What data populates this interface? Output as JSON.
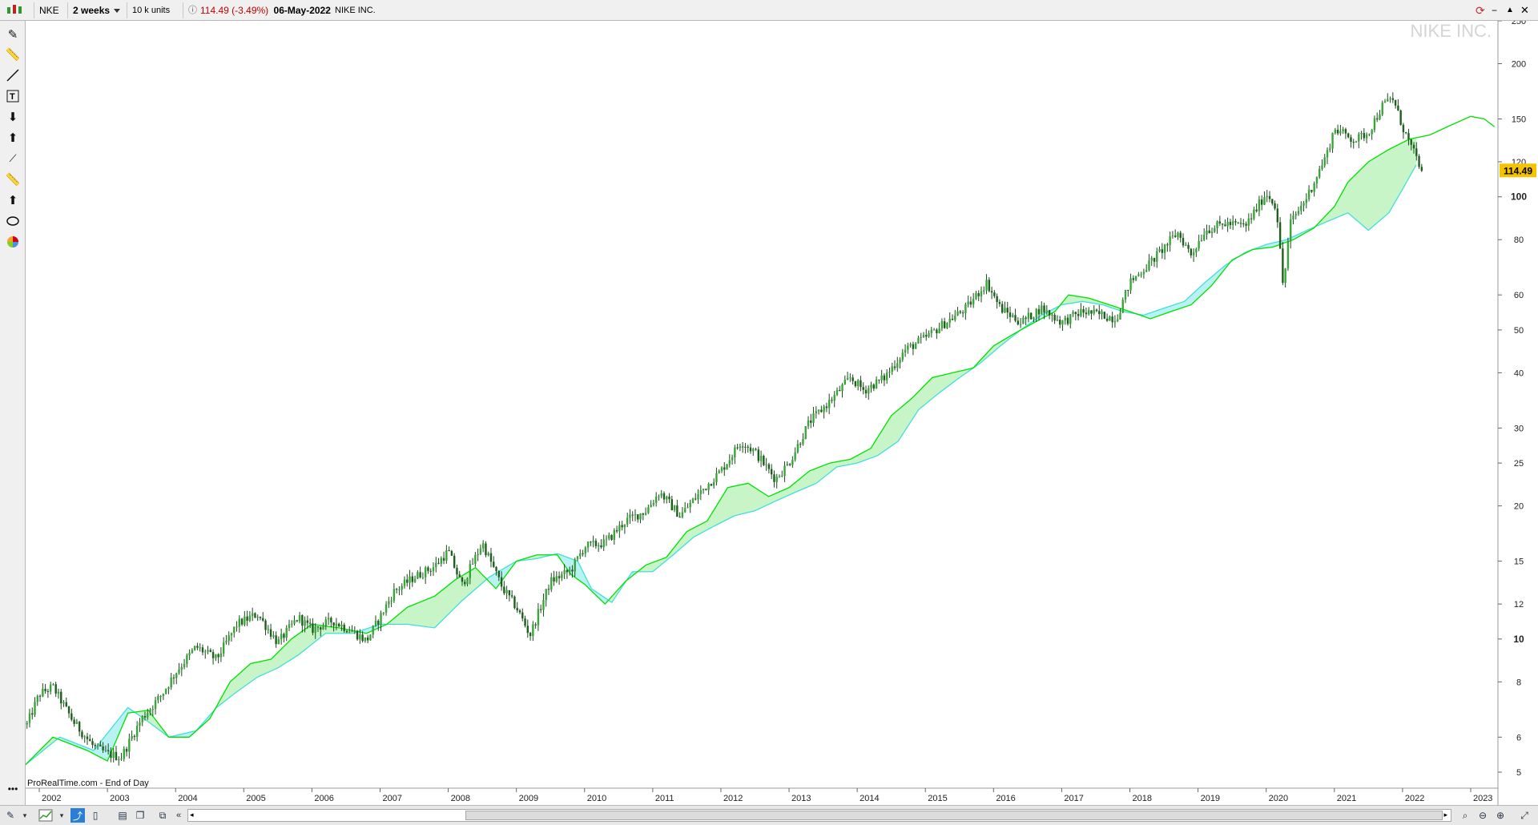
{
  "header": {
    "symbol": "NKE",
    "period": "2 weeks",
    "units": "10 k units",
    "last_price": "114.49",
    "change": "(-3.49%)",
    "date": "06-May-2022",
    "instrument": "NIKE INC."
  },
  "watermark": "NIKE INC.",
  "source_label": "ProRealTime.com - End of Day",
  "price_tag": "114.49",
  "colors": {
    "candle": "#1b7a1b",
    "cloud_bull": "#c8f5c8",
    "cloud_bear": "#b9f2f2",
    "span_a": "#00e000",
    "span_b": "#44dddd",
    "price_tag_bg": "#f5c400"
  },
  "chart_data": {
    "type": "line",
    "yscale": "log",
    "ylim": [
      4.6,
      250
    ],
    "xlim": [
      2001.8,
      2023.4
    ],
    "y_ticks": [
      5,
      6,
      8,
      10,
      12,
      15,
      20,
      25,
      30,
      40,
      50,
      60,
      80,
      100,
      120,
      150,
      200,
      250
    ],
    "y_major_ticks": [
      10,
      100
    ],
    "x_ticks": [
      "2002",
      "2003",
      "2004",
      "2005",
      "2006",
      "2007",
      "2008",
      "2009",
      "2010",
      "2011",
      "2012",
      "2013",
      "2014",
      "2015",
      "2016",
      "2017",
      "2018",
      "2019",
      "2020",
      "2021",
      "2022",
      "2023"
    ],
    "price": {
      "x": [
        2001.8,
        2002.0,
        2002.2,
        2002.5,
        2002.8,
        2003.0,
        2003.2,
        2003.5,
        2003.8,
        2004.0,
        2004.3,
        2004.6,
        2004.9,
        2005.2,
        2005.5,
        2005.8,
        2006.0,
        2006.3,
        2006.6,
        2006.8,
        2007.0,
        2007.2,
        2007.5,
        2007.8,
        2008.0,
        2008.2,
        2008.5,
        2008.8,
        2009.0,
        2009.2,
        2009.5,
        2009.8,
        2010.0,
        2010.3,
        2010.6,
        2010.9,
        2011.1,
        2011.4,
        2011.7,
        2012.0,
        2012.3,
        2012.5,
        2012.8,
        2013.0,
        2013.3,
        2013.6,
        2013.9,
        2014.1,
        2014.4,
        2014.7,
        2015.0,
        2015.3,
        2015.6,
        2015.9,
        2016.1,
        2016.4,
        2016.7,
        2017.0,
        2017.3,
        2017.6,
        2017.8,
        2018.0,
        2018.3,
        2018.7,
        2018.9,
        2019.1,
        2019.4,
        2019.7,
        2020.0,
        2020.15,
        2020.25,
        2020.35,
        2020.6,
        2020.9,
        2021.0,
        2021.3,
        2021.5,
        2021.7,
        2021.85,
        2022.0,
        2022.15,
        2022.3
      ],
      "y": [
        6.3,
        7.5,
        7.8,
        6.5,
        5.7,
        5.5,
        5.4,
        6.6,
        7.5,
        8.4,
        9.6,
        9.0,
        10.8,
        11.4,
        9.8,
        11.2,
        10.5,
        11.0,
        10.4,
        9.9,
        11.2,
        12.8,
        13.8,
        14.6,
        15.8,
        13.2,
        16.5,
        13.0,
        11.8,
        10.2,
        13.5,
        14.3,
        16.2,
        16.5,
        18.5,
        19.5,
        21.5,
        19.0,
        21.5,
        24.0,
        28.0,
        26.5,
        23.0,
        25.0,
        31.0,
        34.5,
        39.0,
        36.5,
        39.0,
        45.0,
        48.0,
        52.0,
        56.0,
        64.0,
        56.0,
        52.0,
        56.0,
        52.0,
        55.0,
        54.0,
        53.0,
        64.0,
        71.0,
        83.0,
        74.0,
        84.0,
        87.0,
        86.0,
        102.0,
        95.0,
        62.0,
        87.0,
        100.0,
        126.0,
        143.0,
        134.0,
        140.0,
        160.0,
        168.0,
        144.0,
        127.0,
        114.49
      ]
    },
    "span_a": {
      "x": [
        2001.8,
        2002.2,
        2002.7,
        2003.0,
        2003.3,
        2003.6,
        2003.9,
        2004.2,
        2004.5,
        2004.8,
        2005.1,
        2005.4,
        2005.7,
        2006.0,
        2006.4,
        2006.8,
        2007.1,
        2007.4,
        2007.8,
        2008.1,
        2008.4,
        2008.7,
        2009.0,
        2009.3,
        2009.6,
        2009.8,
        2010.0,
        2010.3,
        2010.6,
        2010.9,
        2011.2,
        2011.5,
        2011.8,
        2012.1,
        2012.4,
        2012.7,
        2013.0,
        2013.3,
        2013.6,
        2013.9,
        2014.2,
        2014.5,
        2014.8,
        2015.1,
        2015.4,
        2015.7,
        2016.0,
        2016.3,
        2016.6,
        2016.9,
        2017.1,
        2017.4,
        2017.7,
        2018.0,
        2018.3,
        2018.6,
        2018.9,
        2019.2,
        2019.5,
        2019.8,
        2020.1,
        2020.4,
        2020.7,
        2021.0,
        2021.2,
        2021.5,
        2021.8,
        2022.1,
        2022.4,
        2022.7,
        2023.0,
        2023.2,
        2023.35
      ],
      "y": [
        5.2,
        6.0,
        5.6,
        5.3,
        6.8,
        6.9,
        6.0,
        6.0,
        6.6,
        8.0,
        8.8,
        9.0,
        10.0,
        10.8,
        10.6,
        10.3,
        10.8,
        11.8,
        12.5,
        13.6,
        14.5,
        13.0,
        15.0,
        15.5,
        15.5,
        14.0,
        13.3,
        12.0,
        13.5,
        14.7,
        15.3,
        17.5,
        18.5,
        22.0,
        22.5,
        21.0,
        22.0,
        24.0,
        25.0,
        25.5,
        27.0,
        32.0,
        35.0,
        39.0,
        40.0,
        41.0,
        46.0,
        49.0,
        52.0,
        55.0,
        60.0,
        59.0,
        57.0,
        55.0,
        53.0,
        55.0,
        57.0,
        63.0,
        72.0,
        76.0,
        77.0,
        80.0,
        85.0,
        95.0,
        108.0,
        120.0,
        128.0,
        135.0,
        138.0,
        145.0,
        152.0,
        150.0,
        144.0
      ]
    },
    "span_b": {
      "x": [
        2001.8,
        2002.3,
        2002.8,
        2003.3,
        2003.6,
        2003.9,
        2004.3,
        2004.6,
        2004.9,
        2005.2,
        2005.5,
        2005.8,
        2006.2,
        2006.6,
        2007.0,
        2007.4,
        2007.8,
        2008.2,
        2008.6,
        2009.0,
        2009.3,
        2009.6,
        2009.9,
        2010.1,
        2010.4,
        2010.7,
        2011.0,
        2011.3,
        2011.6,
        2011.9,
        2012.2,
        2012.5,
        2012.8,
        2013.1,
        2013.4,
        2013.7,
        2014.0,
        2014.3,
        2014.6,
        2014.9,
        2015.2,
        2015.5,
        2015.8,
        2016.1,
        2016.4,
        2016.7,
        2017.0,
        2017.3,
        2017.6,
        2017.9,
        2018.2,
        2018.5,
        2018.8,
        2019.1,
        2019.4,
        2019.7,
        2020.0,
        2020.3,
        2020.6,
        2020.9,
        2021.2,
        2021.5,
        2021.8,
        2022.0,
        2022.2
      ],
      "y": [
        5.2,
        6.0,
        5.6,
        7.0,
        6.5,
        6.0,
        6.2,
        7.0,
        7.6,
        8.2,
        8.6,
        9.2,
        10.3,
        10.3,
        10.8,
        10.8,
        10.6,
        12.2,
        13.8,
        15.0,
        15.2,
        15.6,
        15.0,
        13.0,
        12.1,
        14.2,
        14.2,
        15.5,
        17.0,
        18.0,
        19.0,
        19.5,
        20.5,
        21.5,
        22.5,
        24.5,
        25.0,
        26.0,
        28.0,
        33.0,
        36.0,
        39.0,
        42.0,
        46.0,
        50.0,
        54.0,
        57.0,
        58.0,
        57.0,
        55.0,
        54.0,
        56.0,
        58.0,
        64.0,
        70.0,
        75.0,
        78.0,
        80.0,
        84.0,
        88.0,
        92.0,
        84.0,
        92.0,
        104.0,
        118.0
      ]
    }
  },
  "tools": [
    "pencil-icon",
    "ruler-icon",
    "line-icon",
    "text-icon",
    "arrow-down-icon",
    "arrow-up-icon",
    "brush-icon",
    "ruler-icon",
    "arrow-up-icon",
    "ellipse-icon",
    "color-wheel-icon"
  ]
}
